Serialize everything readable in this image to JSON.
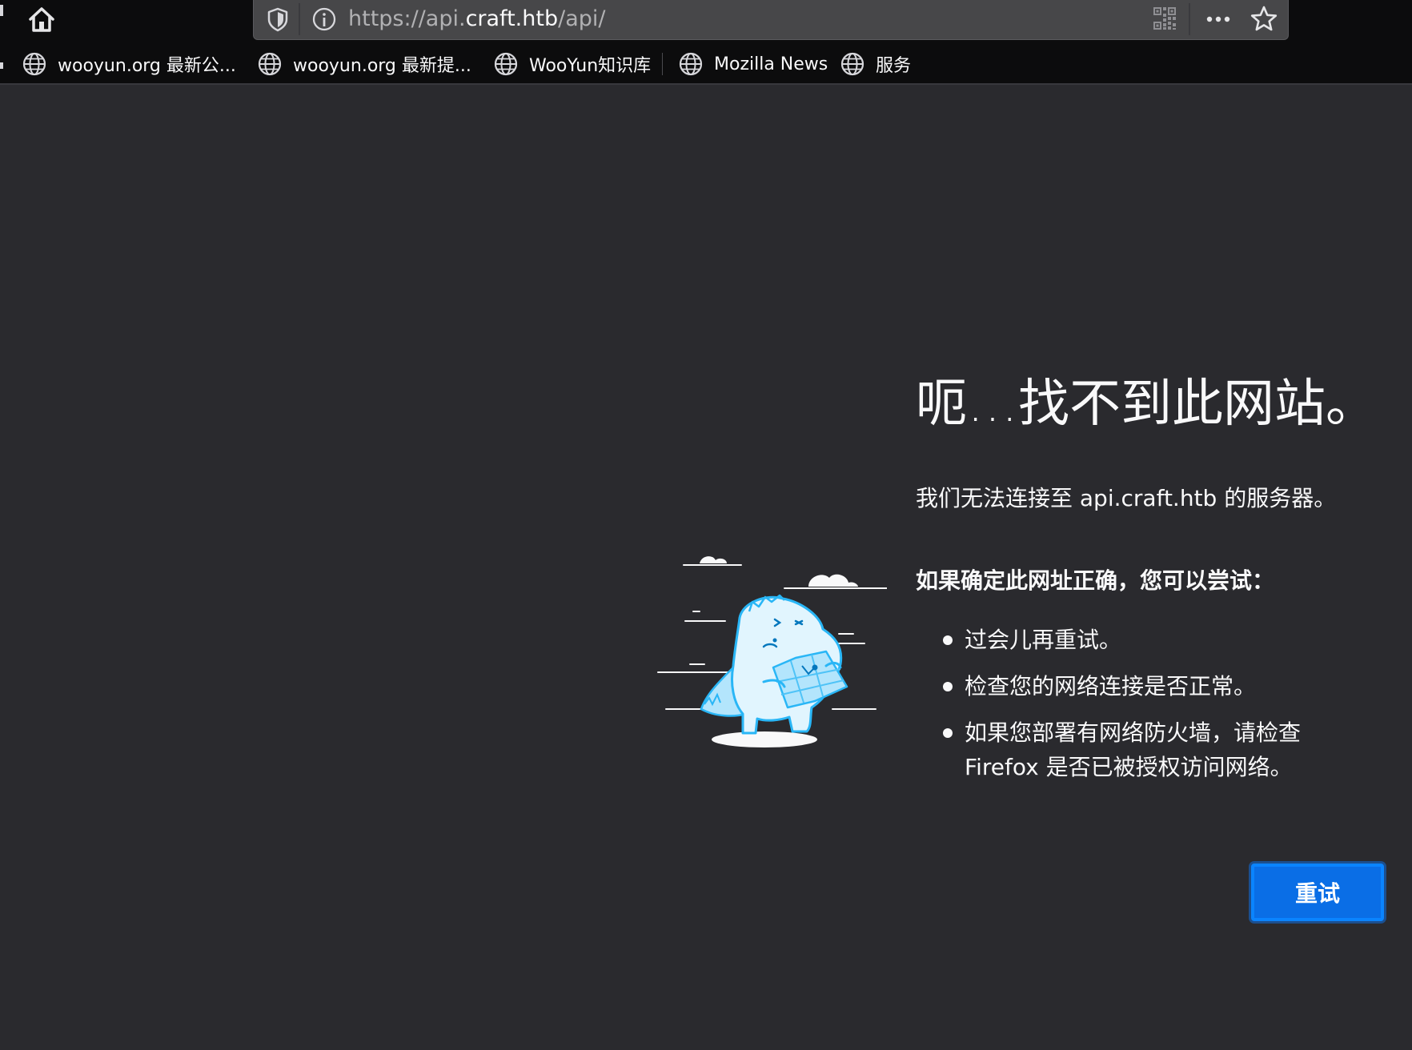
{
  "toolbar": {
    "home_icon": "home-icon",
    "tracking_icon": "shield-icon",
    "site_info_icon": "info-icon",
    "url_prefix": "https://api.",
    "url_host": "craft.htb",
    "url_path": "/api/",
    "qr_icon": "qr-code-icon",
    "page_actions_icon": "ellipsis-icon",
    "bookmark_icon": "star-icon"
  },
  "bookmarks": [
    {
      "label": "wooyun.org 最新公...",
      "icon": "globe-icon"
    },
    {
      "label": "wooyun.org 最新提...",
      "icon": "globe-icon"
    },
    {
      "label": "WooYun知识库",
      "icon": "globe-icon"
    },
    {
      "label": "Mozilla News",
      "icon": "globe-icon"
    },
    {
      "label": "服务",
      "icon": "globe-icon"
    }
  ],
  "error": {
    "title": "呃…找不到此网站。",
    "description": "我们无法连接至 api.craft.htb 的服务器。",
    "subheading": "如果确定此网址正确，您可以尝试：",
    "tips": [
      "过会儿再重试。",
      "检查您的网络连接是否正常。",
      "如果您部署有网络防火墙，请检查 Firefox 是否已被授权访问网络。"
    ],
    "retry_label": "重试"
  },
  "colors": {
    "toolbar_bg": "#0c0c0d",
    "urlbar_bg": "#474749",
    "content_bg": "#2a2a2e",
    "text": "#f9f9fa",
    "button_blue": "#0a6ee6",
    "illustration_blue": "#4fc3f7"
  }
}
